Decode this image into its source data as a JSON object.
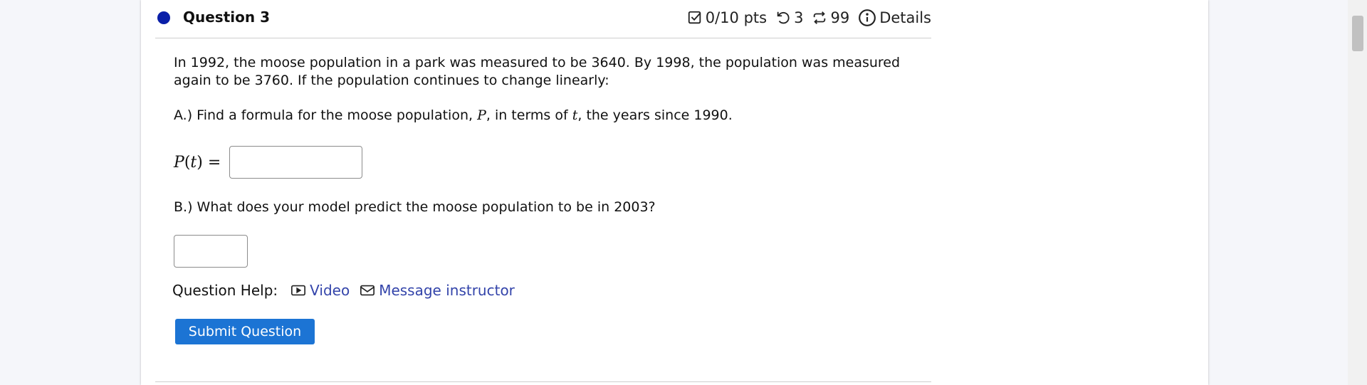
{
  "question": {
    "title": "Question 3",
    "points": "0/10 pts",
    "retries": "3",
    "attempts": "99",
    "details_label": "Details",
    "status_color": "#0a1fa8"
  },
  "body": {
    "prompt": "In 1992, the moose population in a park was measured to be 3640. By 1998, the population was measured again to be 3760. If the population continues to change linearly:",
    "part_a": {
      "prefix": "A.) Find a formula for the moose population, ",
      "var_p": "P",
      "middle": ", in terms of ",
      "var_t": "t",
      "suffix": ", the years since 1990."
    },
    "formula": {
      "fn": "P",
      "open": "(",
      "arg": "t",
      "close": ")",
      "equals": "=",
      "value": ""
    },
    "part_b": {
      "text": "B.) What does your model predict the moose population to be in 2003?",
      "value": ""
    }
  },
  "help": {
    "label": "Question Help:",
    "video_label": "Video",
    "message_label": "Message instructor",
    "link_color": "#3344aa"
  },
  "actions": {
    "submit_label": "Submit Question",
    "submit_color": "#1c74d4"
  },
  "icons": {
    "score": "checkbox-icon",
    "retry": "retry-icon",
    "attempts": "repeat-icon",
    "details": "info-icon",
    "video": "video-icon",
    "message": "mail-icon"
  }
}
